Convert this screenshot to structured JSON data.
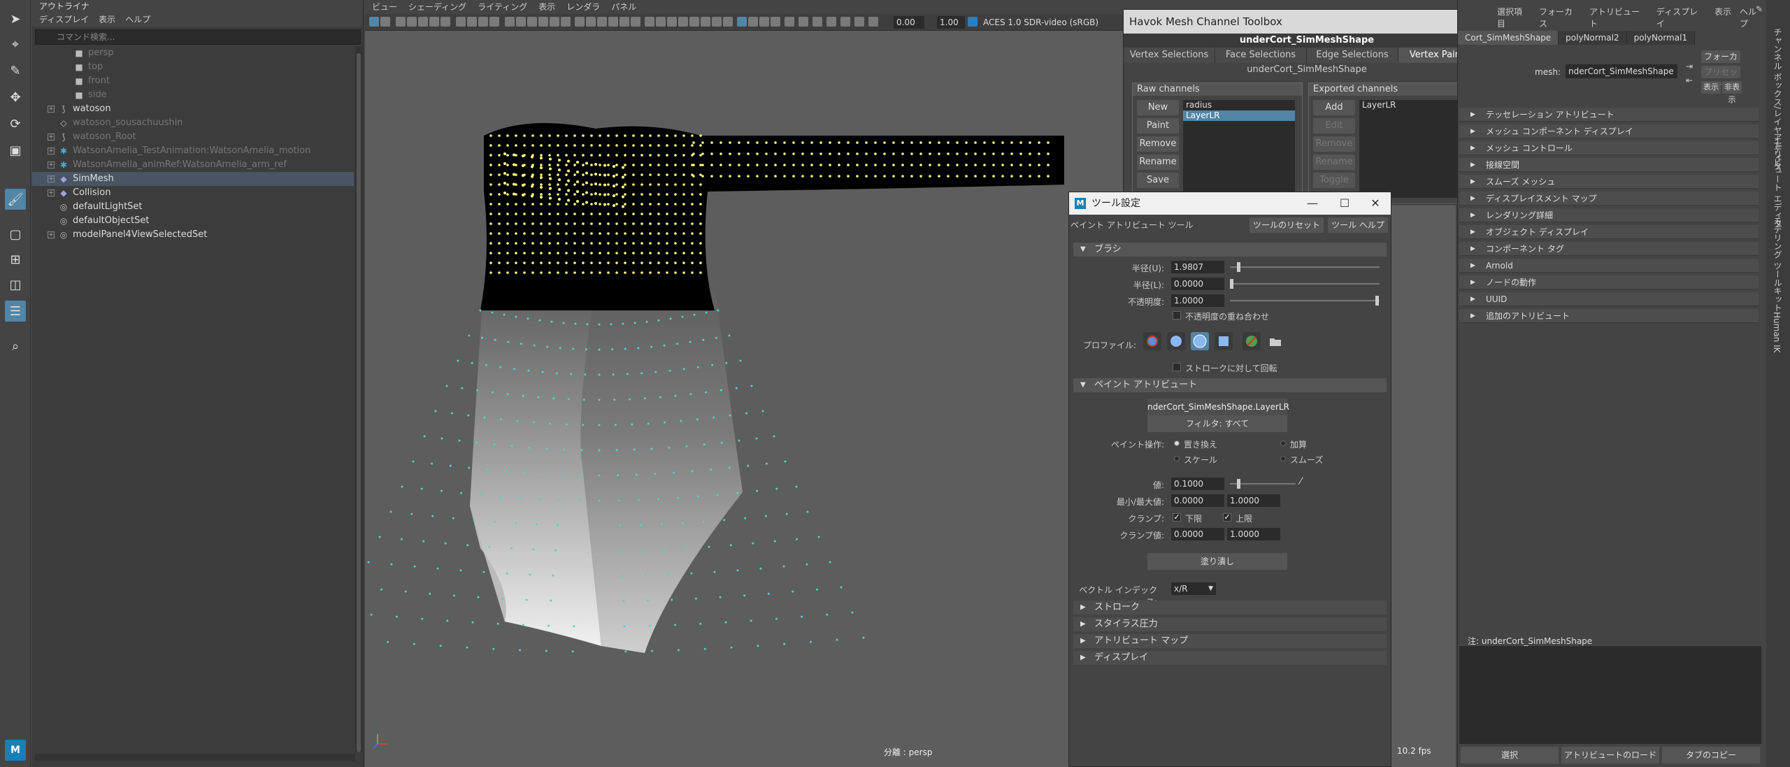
{
  "outliner": {
    "title": "アウトライナ",
    "menu": [
      "ディスプレイ",
      "表示",
      "ヘルプ"
    ],
    "search_placeholder": "コマンド検索...",
    "items": [
      {
        "label": "persp",
        "icon": "camera-icon",
        "hidden": true,
        "child": true
      },
      {
        "label": "top",
        "icon": "camera-icon",
        "hidden": true,
        "child": true
      },
      {
        "label": "front",
        "icon": "camera-icon",
        "hidden": true,
        "child": true
      },
      {
        "label": "side",
        "icon": "camera-icon",
        "hidden": true,
        "child": true
      },
      {
        "label": "watoson",
        "icon": "joint-icon",
        "expandable": true
      },
      {
        "label": "watoson_sousachuushin",
        "icon": "transform-icon",
        "hidden": true
      },
      {
        "label": "watoson_Root",
        "icon": "joint-icon",
        "hidden": true,
        "expandable": true
      },
      {
        "label": "WatsonAmelia_TestAnimation:WatsonAmelia_motion",
        "icon": "reference-icon",
        "hidden": true,
        "expandable": true
      },
      {
        "label": "WatsonAmelia_animRef:WatsonAmelia_arm_ref",
        "icon": "reference-icon",
        "hidden": true,
        "expandable": true
      },
      {
        "label": "SimMesh",
        "icon": "mesh-icon",
        "selected": true,
        "expandable": true
      },
      {
        "label": "Collision",
        "icon": "mesh-icon",
        "expandable": true
      },
      {
        "label": "defaultLightSet",
        "icon": "set-icon"
      },
      {
        "label": "defaultObjectSet",
        "icon": "set-icon"
      },
      {
        "label": "modelPanel4ViewSelectedSet",
        "icon": "set-icon",
        "expandable": true
      }
    ]
  },
  "viewport": {
    "menu": [
      "ビュー",
      "シェーディング",
      "ライティング",
      "表示",
      "レンダラ",
      "パネル"
    ],
    "exposure": "0.00",
    "gamma": "1.00",
    "color_space": "ACES 1.0 SDR-video (sRGB)",
    "camera_label": "分離 : persp",
    "fps": "10.2 fps"
  },
  "havok": {
    "window_title": "Havok Mesh Channel Toolbox",
    "mesh_name": "underCort_SimMeshShape",
    "tabs": [
      "Vertex Selections",
      "Face Selections",
      "Edge Selections",
      "Vertex Painting"
    ],
    "active_tab": "Vertex Painting",
    "sub_title": "underCort_SimMeshShape",
    "raw": {
      "title": "Raw channels",
      "buttons": [
        "New",
        "Paint",
        "Remove",
        "Rename",
        "Save"
      ],
      "items": [
        "radius",
        "LayerLR"
      ],
      "selected": "LayerLR"
    },
    "exported": {
      "title": "Exported channels",
      "buttons": [
        "Add",
        "Edit",
        "Remove",
        "Rename",
        "Toggle"
      ],
      "items": [
        "LayerLR"
      ]
    }
  },
  "tool_settings": {
    "window_title": "ツール設定",
    "tool_name": "ペイント アトリビュート ツール",
    "reset_label": "ツールのリセット",
    "help_label": "ツール ヘルプ",
    "brush": {
      "section": "ブラシ",
      "radius_u_label": "半径(U):",
      "radius_u": "1.9807",
      "radius_l_label": "半径(L):",
      "radius_l": "0.0000",
      "opacity_label": "不透明度:",
      "opacity": "1.0000",
      "accumulate_label": "不透明度の重ね合わせ",
      "profile_label": "プロファイル:",
      "rotate_label": "ストロークに対して回転"
    },
    "paint_attr": {
      "section": "ペイント アトリビュート",
      "attribute": "nderCort_SimMeshShape.LayerLR",
      "filter": "フィルタ: すべて",
      "op_label": "ペイント操作:",
      "ops": [
        "置き換え",
        "加算",
        "スケール",
        "スムーズ"
      ],
      "op_selected": "置き換え",
      "value_label": "値:",
      "value": "0.1000",
      "minmax_label": "最小/最大値:",
      "min": "0.0000",
      "max": "1.0000",
      "clamp_label": "クランプ:",
      "clamp_lower": "下限",
      "clamp_upper": "上限",
      "clamp_val_label": "クランプ値:",
      "clamp_min": "0.0000",
      "clamp_max": "1.0000",
      "flood": "塗り潰し",
      "vector_label": "ベクトル インデックス:",
      "vector_value": "x/R"
    },
    "collapsed_sections": [
      "ストローク",
      "スタイラス圧力",
      "アトリビュート マップ",
      "ディスプレイ"
    ]
  },
  "attribute_editor": {
    "menu": [
      "選択項目",
      "フォーカス",
      "アトリビュート",
      "ディスプレイ",
      "表示",
      "ヘルプ"
    ],
    "tabs": [
      "Cort_SimMeshShape",
      "polyNormal2",
      "polyNormal1"
    ],
    "mesh_label": "mesh:",
    "mesh_value": "nderCort_SimMeshShape",
    "focus_btn": "フォーカス",
    "preset_btn": "プリセット",
    "show_btn": "表示",
    "hide_btn": "非表示",
    "sections": [
      "テッセレーション アトリビュート",
      "メッシュ コンポーネント ディスプレイ",
      "メッシュ コントロール",
      "接線空間",
      "スムーズ メッシュ",
      "ディスプレイスメント マップ",
      "レンダリング詳細",
      "オブジェクト ディスプレイ",
      "コンポーネント タグ",
      "Arnold",
      "ノードの動作",
      "UUID",
      "追加のアトリビュート"
    ],
    "notes_label": "注: underCort_SimMeshShape",
    "bottom_buttons": [
      "選択",
      "アトリビュートのロード",
      "タブのコピー"
    ]
  },
  "side_tabs": [
    "チャンネル ボックス/レイヤ エディタ",
    "アトリビュート エディタ",
    "モデリング ツールキット",
    "Human IK"
  ],
  "colors": {
    "selection": "#5285a6",
    "viewport_bg": "#5d5d5d",
    "vertex_yellow": "#ffff80",
    "vertex_teal": "#4fd6c0"
  }
}
